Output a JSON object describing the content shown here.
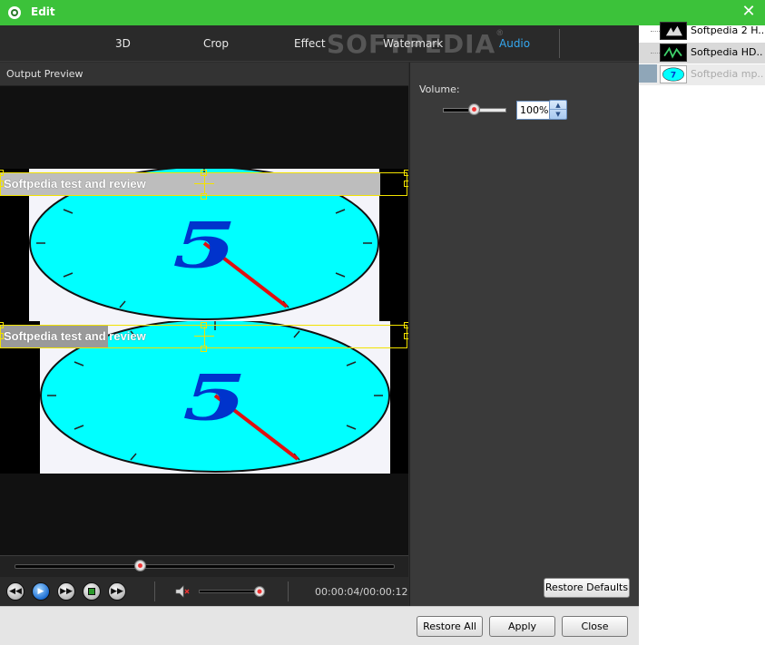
{
  "window": {
    "title": "Edit"
  },
  "tabs": [
    {
      "label": "3D",
      "active": false
    },
    {
      "label": "Crop",
      "active": false
    },
    {
      "label": "Effect",
      "active": false
    },
    {
      "label": "Watermark",
      "active": false
    },
    {
      "label": "Audio",
      "active": true
    }
  ],
  "watermark_logo": "SOFTPEDIA",
  "preview": {
    "label": "Output Preview",
    "watermark_text": "Softpedia test and review",
    "clock_digit": "5"
  },
  "playback": {
    "seek_fraction": 0.33,
    "volume_fraction": 0.95,
    "timecode": "00:00:04/00:00:12"
  },
  "audio": {
    "volume_label": "Volume:",
    "volume_value": "100%",
    "volume_slider_fraction": 0.5,
    "restore_defaults_label": "Restore Defaults"
  },
  "buttons": {
    "restore_all": "Restore All",
    "apply": "Apply",
    "close": "Close"
  },
  "files": [
    {
      "name": "Softpedia 2 H...",
      "state": "normal"
    },
    {
      "name": "Softpedia HD....",
      "state": "selected"
    },
    {
      "name": "Softpedia mp...",
      "state": "dim"
    }
  ],
  "colors": {
    "titlebar": "#3cc23a",
    "active_tab": "#35a8f0",
    "watermark_border": "#f2e200",
    "clock_face": "#00ffff",
    "digit": "#0033cc",
    "hand": "#e01010"
  }
}
